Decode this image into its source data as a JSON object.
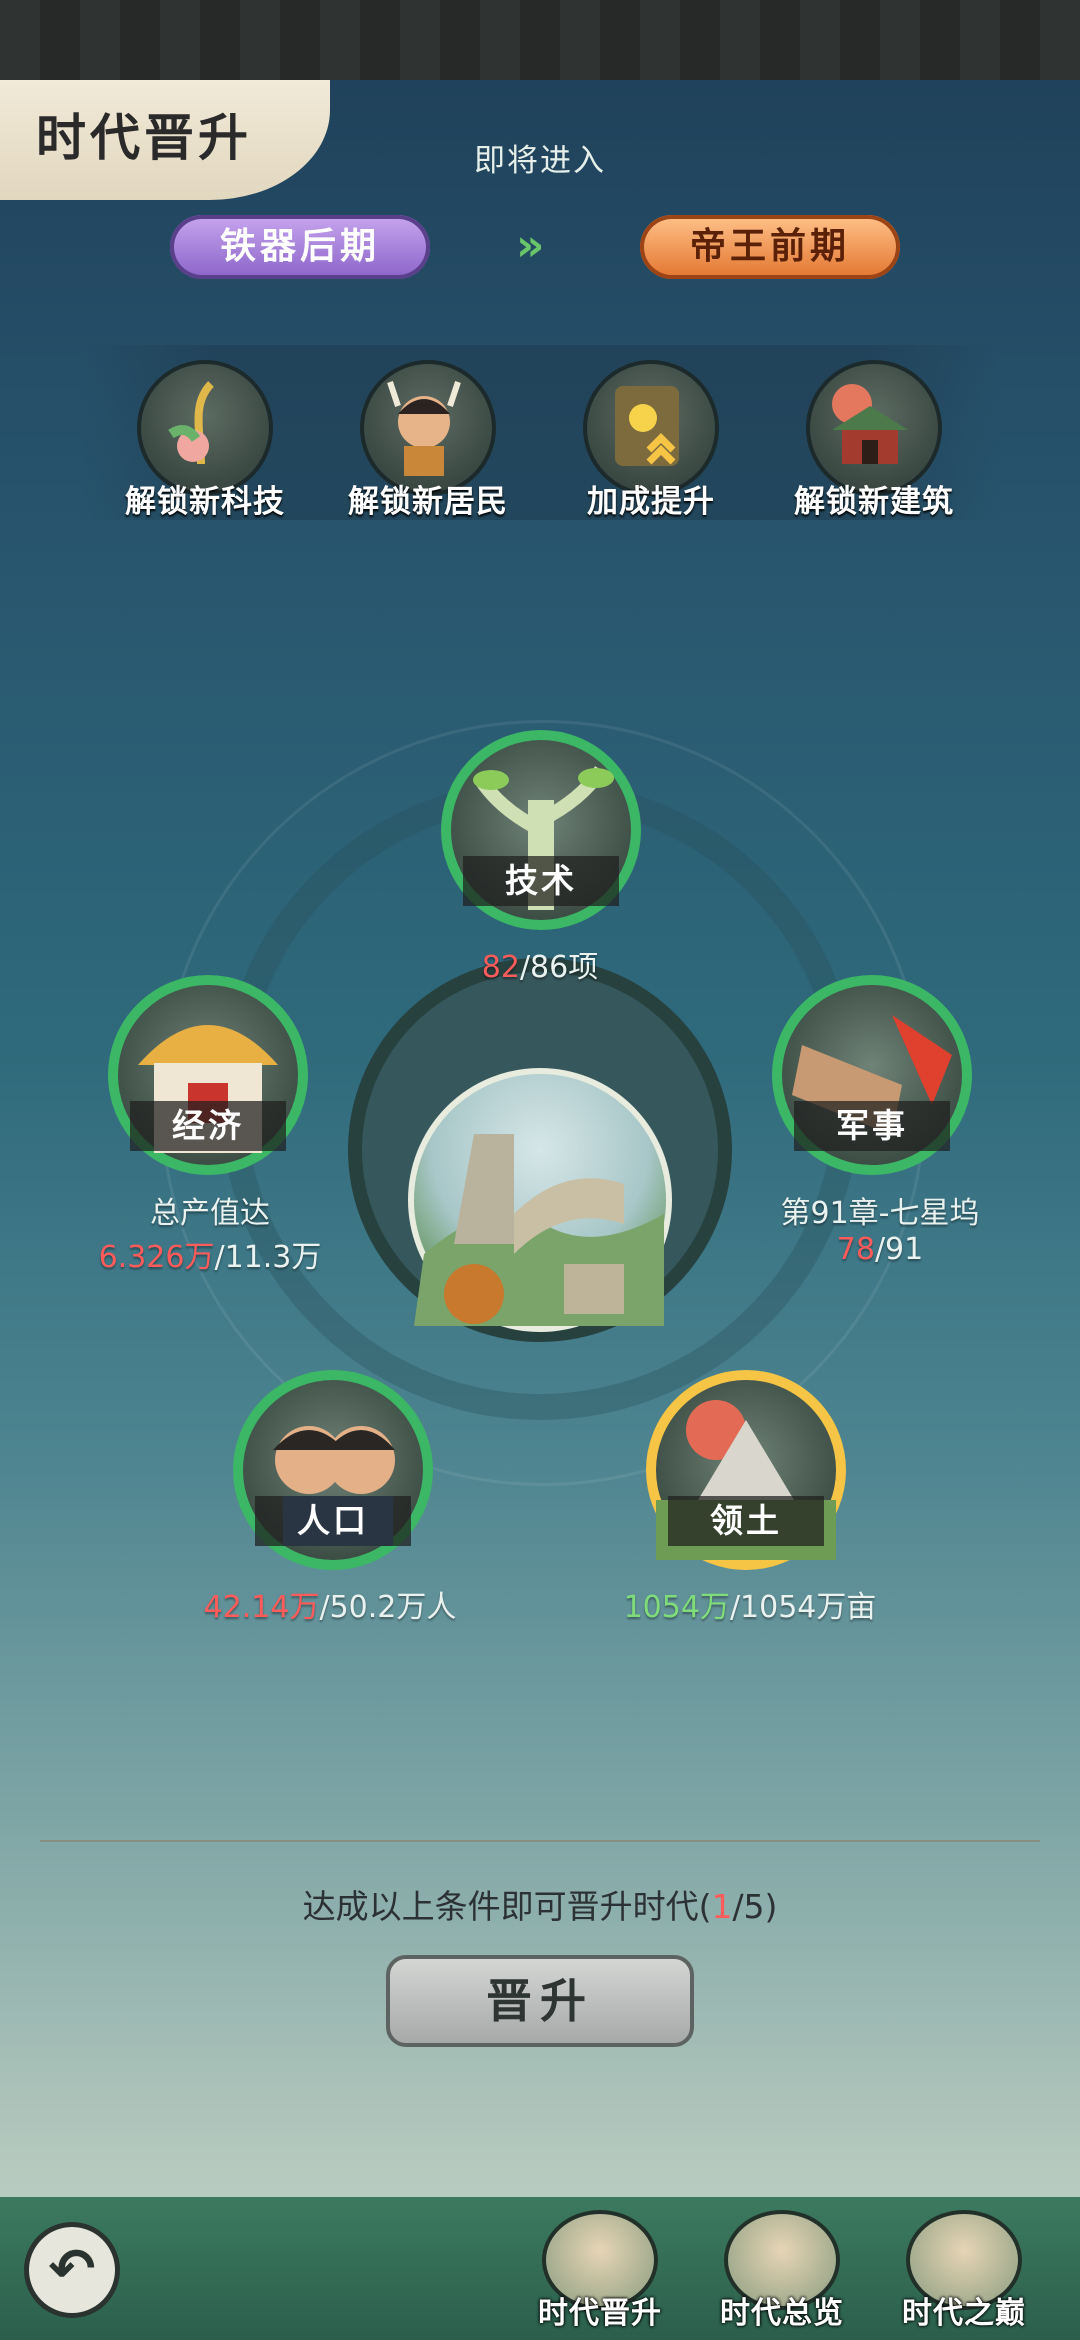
{
  "header": {
    "title": "时代晋升",
    "entering_label": "即将进入"
  },
  "eras": {
    "current": "铁器后期",
    "next": "帝王前期"
  },
  "unlocks": [
    {
      "label": "解锁新科技",
      "icon": "tech-plant-icon"
    },
    {
      "label": "解锁新居民",
      "icon": "resident-icon"
    },
    {
      "label": "加成提升",
      "icon": "bonus-up-icon"
    },
    {
      "label": "解锁新建筑",
      "icon": "building-icon"
    }
  ],
  "conditions": {
    "tech": {
      "label": "技术",
      "current": "82",
      "total": "/86项"
    },
    "economy": {
      "label": "经济",
      "desc": "总产值达",
      "current": "6.326万",
      "total": "/11.3万"
    },
    "military": {
      "label": "军事",
      "desc": "第91章-七星坞",
      "current": "78",
      "total": "/91"
    },
    "population": {
      "label": "人口",
      "current": "42.14万",
      "total": "/50.2万人"
    },
    "territory": {
      "label": "领土",
      "current": "1054万",
      "total": "/1054万亩"
    }
  },
  "summary": {
    "prefix": "达成以上条件即可晋升时代(",
    "achieved": "1",
    "suffix": "/5)"
  },
  "promote_button": "晋升",
  "bottom_tabs": [
    {
      "label": "时代晋升"
    },
    {
      "label": "时代总览"
    },
    {
      "label": "时代之巅"
    }
  ],
  "colors": {
    "accent_green": "#3bb766",
    "accent_gold": "#f6c545",
    "warning_red": "#ff5b5b"
  }
}
